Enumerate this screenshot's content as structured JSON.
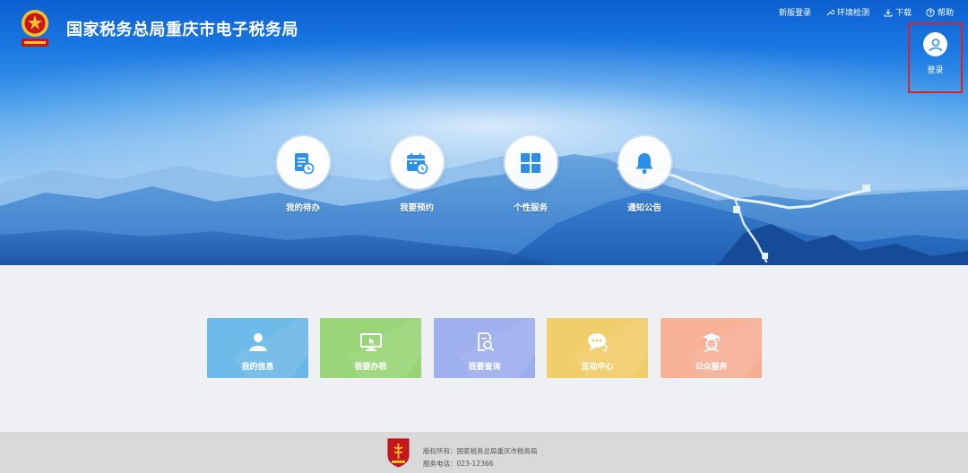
{
  "header": {
    "logo_name": "tax-emblem-logo",
    "title": "国家税务总局重庆市电子税务局"
  },
  "toplinks": [
    {
      "label": "新版登录",
      "icon": ""
    },
    {
      "label": "环境检测",
      "icon": "wrench-icon"
    },
    {
      "label": "下载",
      "icon": "download-icon"
    },
    {
      "label": "帮助",
      "icon": "help-icon"
    }
  ],
  "login": {
    "label": "登录",
    "icon": "user-icon"
  },
  "hero_buttons": [
    {
      "label": "我的待办",
      "icon": "todo-doc-clock-icon"
    },
    {
      "label": "我要预约",
      "icon": "calendar-clock-icon"
    },
    {
      "label": "个性服务",
      "icon": "grid-icon"
    },
    {
      "label": "通知公告",
      "icon": "bell-icon"
    }
  ],
  "tiles": [
    {
      "label": "我的信息",
      "icon": "person-icon",
      "color": "#5eb3e6"
    },
    {
      "label": "我要办税",
      "icon": "monitor-cursor-icon",
      "color": "#8fd16a"
    },
    {
      "label": "我要查询",
      "icon": "doc-search-icon",
      "color": "#94a8ec"
    },
    {
      "label": "互动中心",
      "icon": "chat-icon",
      "color": "#f0c95c"
    },
    {
      "label": "公众服务",
      "icon": "graduate-icon",
      "color": "#f5a98c"
    }
  ],
  "footer": {
    "copyright": "版权所有：国家税务总局重庆市税务局",
    "phone": "服务电话：023-12366"
  },
  "colors": {
    "accent_blue": "#2b8fe8",
    "login_border": "#d9232a",
    "footer_bg": "#d9d9d9"
  }
}
